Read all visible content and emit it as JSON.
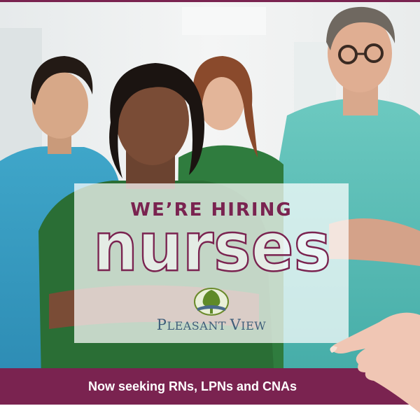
{
  "headline": "WE’RE HIRING",
  "role": "nurses",
  "brand": {
    "name_lead_P": "P",
    "name_rest_1": "LEASANT ",
    "name_lead_V": "V",
    "name_rest_2": "IEW"
  },
  "banner": {
    "text": "Now seeking RNs, LPNs and CNAs"
  },
  "colors": {
    "maroon": "#7a2350",
    "teal_scrubs": "#5fc2b6",
    "green_scrubs": "#2e7a3a",
    "logo_green": "#6a8a2a",
    "logo_blue": "#4a6a8a"
  },
  "icons": {
    "logo": "tree-logo-icon"
  }
}
